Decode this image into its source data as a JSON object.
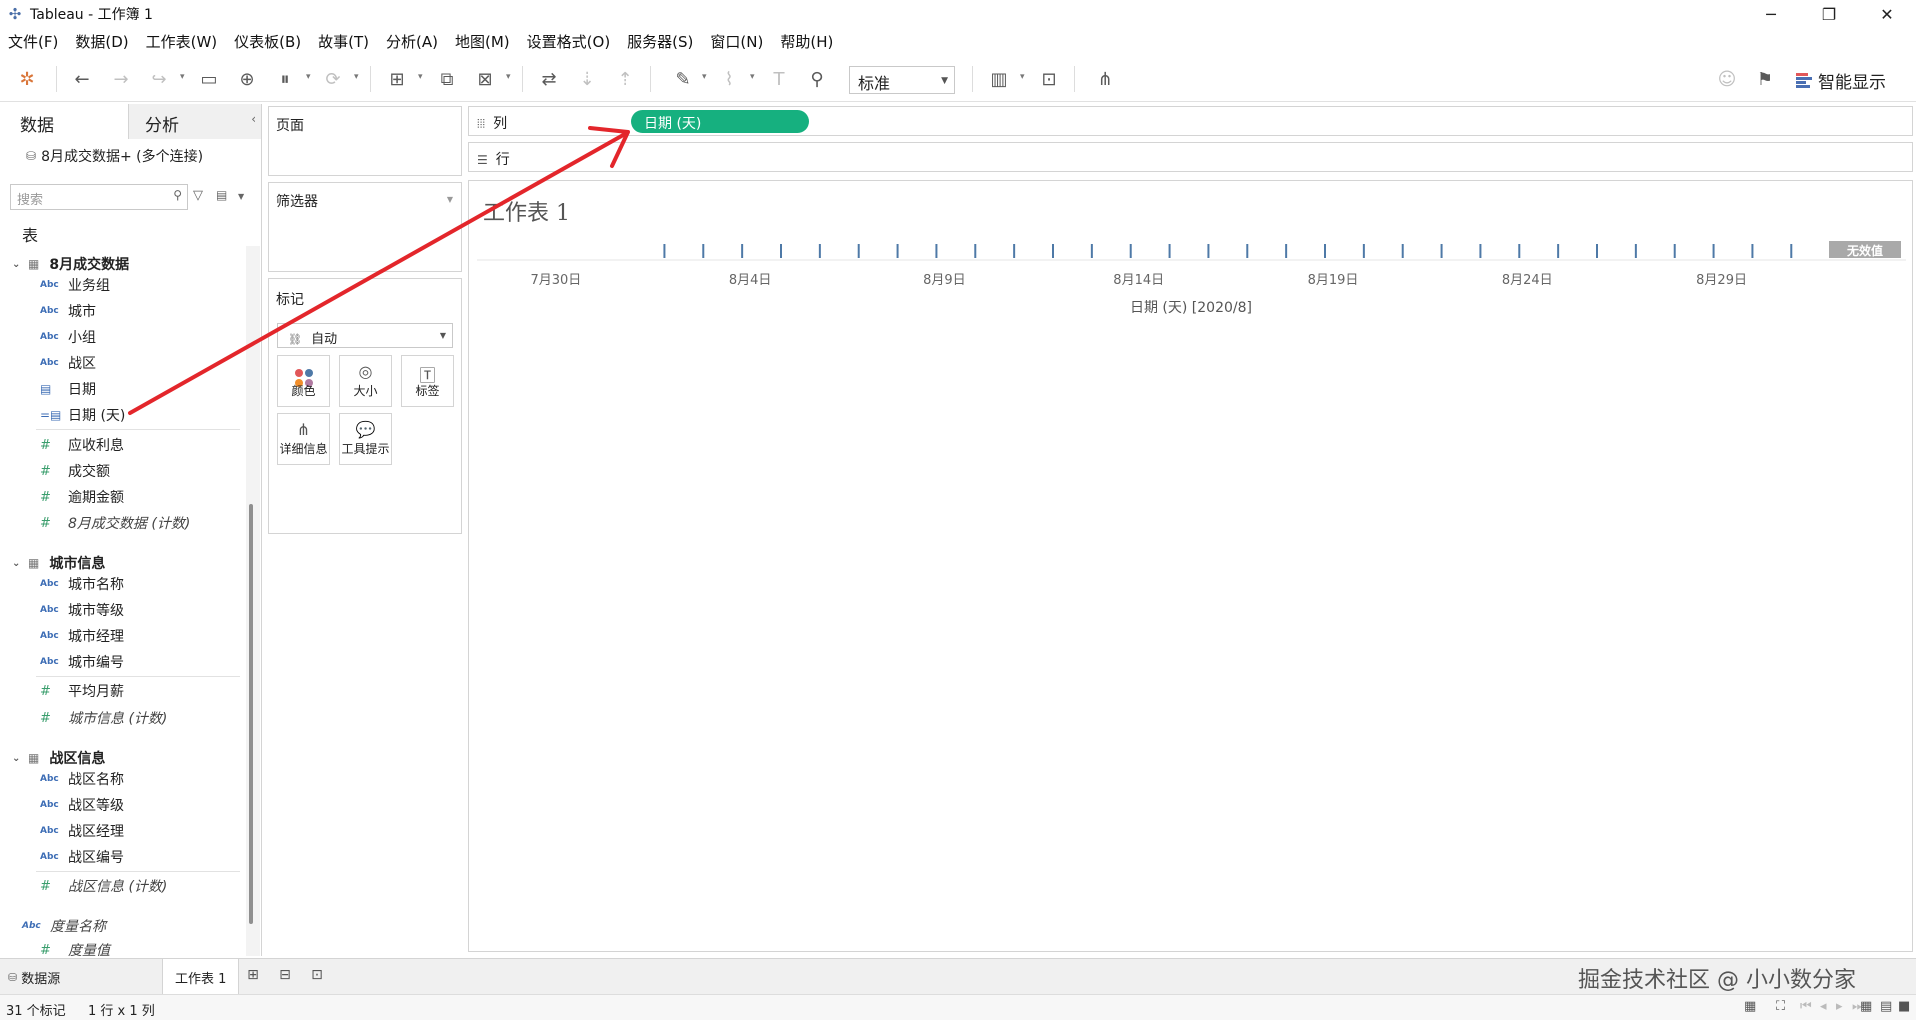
{
  "window": {
    "title": "Tableau - 工作簿 1"
  },
  "menu": [
    "文件(F)",
    "数据(D)",
    "工作表(W)",
    "仪表板(B)",
    "故事(T)",
    "分析(A)",
    "地图(M)",
    "设置格式(O)",
    "服务器(S)",
    "窗口(N)",
    "帮助(H)"
  ],
  "toolbar": {
    "fit_value": "标准",
    "smart_show": "智能显示"
  },
  "data_pane": {
    "tab_data": "数据",
    "tab_analysis": "分析",
    "connection": "8月成交数据+ (多个连接)",
    "search_placeholder": "搜索",
    "tables_label": "表",
    "groups": [
      {
        "name": "8月成交数据",
        "dimensions": [
          {
            "type": "Abc",
            "name": "业务组"
          },
          {
            "type": "Abc",
            "name": "城市"
          },
          {
            "type": "Abc",
            "name": "小组"
          },
          {
            "type": "Abc",
            "name": "战区"
          },
          {
            "type": "date",
            "name": "日期"
          },
          {
            "type": "date",
            "name": "日期 (天)"
          }
        ],
        "measures": [
          {
            "name": "应收利息"
          },
          {
            "name": "成交额"
          },
          {
            "name": "逾期金额"
          },
          {
            "name": "8月成交数据 (计数)"
          }
        ]
      },
      {
        "name": "城市信息",
        "dimensions": [
          {
            "type": "Abc",
            "name": "城市名称"
          },
          {
            "type": "Abc",
            "name": "城市等级"
          },
          {
            "type": "Abc",
            "name": "城市经理"
          },
          {
            "type": "Abc",
            "name": "城市编号"
          }
        ],
        "measures": [
          {
            "name": "平均月薪"
          },
          {
            "name": "城市信息 (计数)"
          }
        ]
      },
      {
        "name": "战区信息",
        "dimensions": [
          {
            "type": "Abc",
            "name": "战区名称"
          },
          {
            "type": "Abc",
            "name": "战区等级"
          },
          {
            "type": "Abc",
            "name": "战区经理"
          },
          {
            "type": "Abc",
            "name": "战区编号"
          }
        ],
        "measures": [
          {
            "name": "战区信息 (计数)"
          }
        ]
      }
    ],
    "extra": [
      {
        "type": "Abc",
        "name": "度量名称"
      },
      {
        "type": "#",
        "name": "度量值"
      }
    ]
  },
  "cards": {
    "pages": "页面",
    "filters": "筛选器",
    "marks": "标记",
    "mark_type": "自动",
    "mark_buttons": [
      "颜色",
      "大小",
      "标签",
      "详细信息",
      "工具提示"
    ]
  },
  "shelves": {
    "columns": "列",
    "rows": "行",
    "column_pill": "日期 (天)"
  },
  "view": {
    "sheet_title": "工作表 1",
    "null_badge": "无效值"
  },
  "chart_data": {
    "type": "strip",
    "x_field": "日期 (天)",
    "xlabel": "日期 (天) [2020/8]",
    "tick_labels": [
      "7月30日",
      "8月4日",
      "8月9日",
      "8月14日",
      "8月19日",
      "8月24日",
      "8月29日"
    ],
    "tick_days": [
      -2,
      3,
      8,
      13,
      18,
      23,
      28
    ],
    "mark_days": [
      1,
      2,
      3,
      4,
      5,
      6,
      7,
      8,
      9,
      10,
      11,
      12,
      13,
      14,
      15,
      16,
      17,
      18,
      19,
      20,
      21,
      22,
      23,
      24,
      25,
      26,
      27,
      28,
      29,
      30,
      31
    ],
    "xlim_days": [
      -3,
      32
    ]
  },
  "bottom": {
    "datasource_tab": "数据源",
    "sheet_tab": "工作表 1",
    "watermark": "掘金技术社区 @ 小小数分家"
  },
  "status": {
    "marks": "31 个标记",
    "rows_cols": "1 行 x 1 列"
  },
  "colors": {
    "pill": "#16b07f",
    "mark": "#4e79a7",
    "annotation_arrow": "#e3262b"
  }
}
